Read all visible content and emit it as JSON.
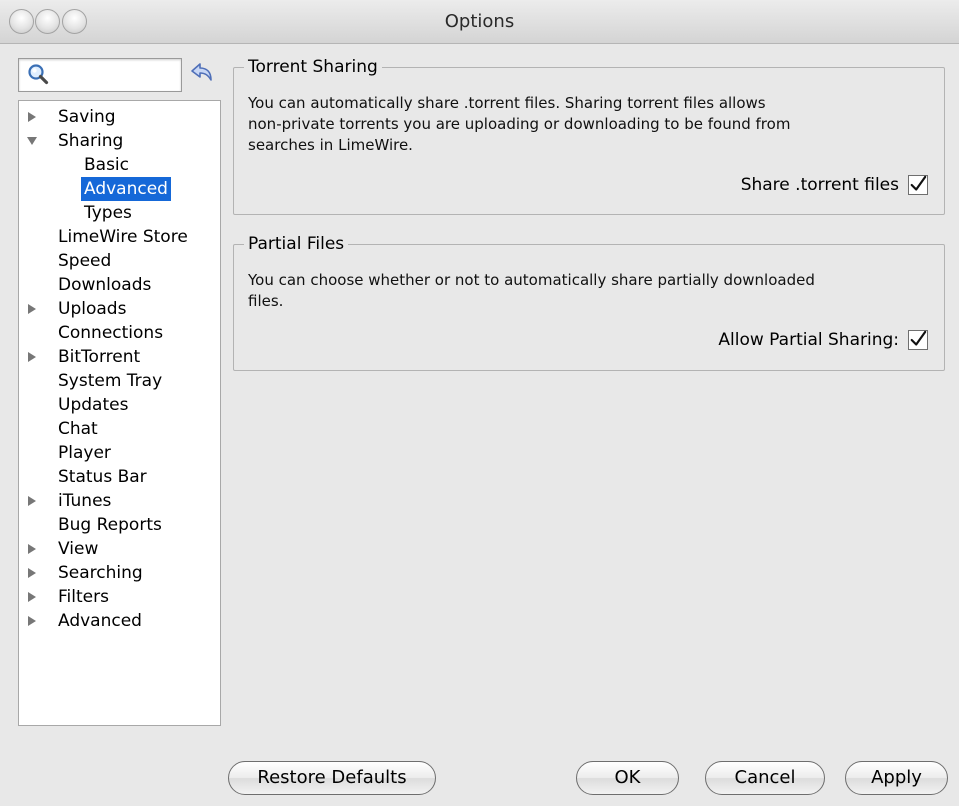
{
  "window": {
    "title": "Options"
  },
  "sidebar": {
    "search": {
      "value": ""
    },
    "tree": [
      {
        "label": "Saving",
        "arrow": "collapsed",
        "depth": 0
      },
      {
        "label": "Sharing",
        "arrow": "expanded",
        "depth": 0
      },
      {
        "label": "Basic",
        "arrow": "none",
        "depth": 1
      },
      {
        "label": "Advanced",
        "arrow": "none",
        "depth": 1,
        "selected": true
      },
      {
        "label": "Types",
        "arrow": "none",
        "depth": 1
      },
      {
        "label": "LimeWire Store",
        "arrow": "none",
        "depth": 0
      },
      {
        "label": "Speed",
        "arrow": "none",
        "depth": 0
      },
      {
        "label": "Downloads",
        "arrow": "none",
        "depth": 0
      },
      {
        "label": "Uploads",
        "arrow": "collapsed",
        "depth": 0
      },
      {
        "label": "Connections",
        "arrow": "none",
        "depth": 0
      },
      {
        "label": "BitTorrent",
        "arrow": "collapsed",
        "depth": 0
      },
      {
        "label": "System Tray",
        "arrow": "none",
        "depth": 0
      },
      {
        "label": "Updates",
        "arrow": "none",
        "depth": 0
      },
      {
        "label": "Chat",
        "arrow": "none",
        "depth": 0
      },
      {
        "label": "Player",
        "arrow": "none",
        "depth": 0
      },
      {
        "label": "Status Bar",
        "arrow": "none",
        "depth": 0
      },
      {
        "label": "iTunes",
        "arrow": "collapsed",
        "depth": 0
      },
      {
        "label": "Bug Reports",
        "arrow": "none",
        "depth": 0
      },
      {
        "label": "View",
        "arrow": "collapsed",
        "depth": 0
      },
      {
        "label": "Searching",
        "arrow": "collapsed",
        "depth": 0
      },
      {
        "label": "Filters",
        "arrow": "collapsed",
        "depth": 0
      },
      {
        "label": "Advanced",
        "arrow": "collapsed",
        "depth": 0
      }
    ]
  },
  "torrent_sharing": {
    "title": "Torrent Sharing",
    "desc_lines": [
      "You can automatically share .torrent files. Sharing torrent files allows",
      "non-private torrents you are uploading or downloading to be found from",
      "searches in LimeWire."
    ],
    "checkbox_label": "Share .torrent files",
    "checked": true
  },
  "partial_files": {
    "title": "Partial Files",
    "desc_lines": [
      "You can choose whether or not to automatically share partially downloaded",
      "files."
    ],
    "checkbox_label": "Allow Partial Sharing:",
    "checked": true
  },
  "buttons": {
    "restore_defaults": "Restore Defaults",
    "ok": "OK",
    "cancel": "Cancel",
    "apply": "Apply"
  },
  "colors": {
    "selection": "#1568d8",
    "background": "#e8e8e8"
  }
}
